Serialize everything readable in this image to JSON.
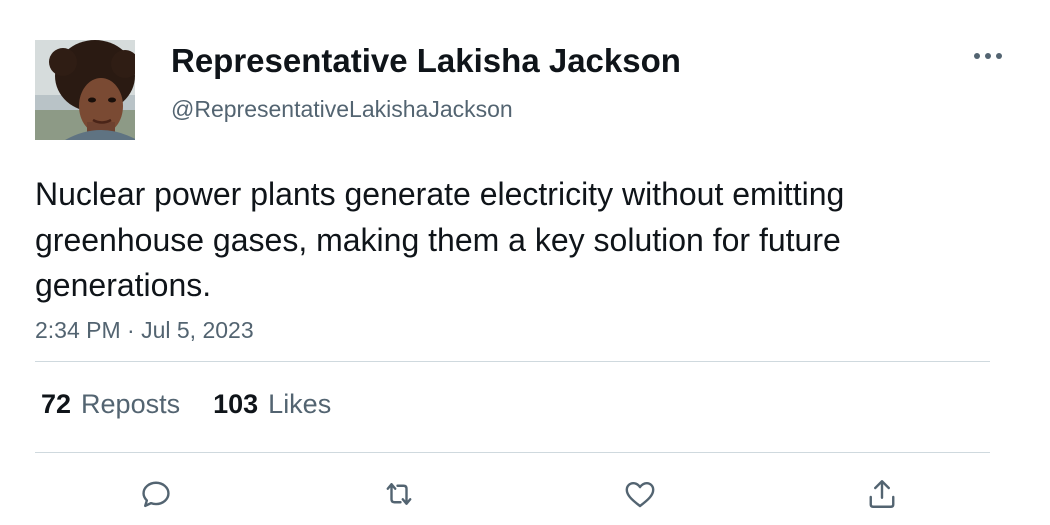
{
  "author": {
    "name": "Representative Lakisha Jackson",
    "handle": "@RepresentativeLakishaJackson",
    "avatar_icon": "profile-photo"
  },
  "menu_icon": "more-horizontal-icon",
  "tweet": {
    "text": "Nuclear power plants generate electricity without emitting greenhouse gases, making them a key solution for future generations.",
    "timestamp": "2:34 PM · Jul 5, 2023"
  },
  "stats": {
    "reposts_count": "72",
    "reposts_label": "Reposts",
    "likes_count": "103",
    "likes_label": "Likes"
  },
  "actions": [
    {
      "icon": "reply-icon"
    },
    {
      "icon": "repost-icon"
    },
    {
      "icon": "like-icon"
    },
    {
      "icon": "share-icon"
    }
  ],
  "colors": {
    "primary_text": "#0f1419",
    "secondary_text": "#536471",
    "divider": "#cfd9de"
  }
}
